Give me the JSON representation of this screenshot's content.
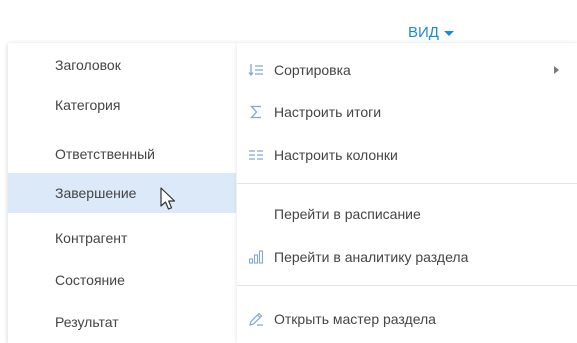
{
  "header": {
    "view_label": "ВИД"
  },
  "left_menu": {
    "items": [
      {
        "label": "Заголовок"
      },
      {
        "label": "Категория"
      },
      {
        "label": "Ответственный"
      },
      {
        "label": "Завершение"
      },
      {
        "label": "Контрагент"
      },
      {
        "label": "Состояние"
      },
      {
        "label": "Результат"
      }
    ],
    "active_item": "Завершение"
  },
  "right_menu": {
    "items": [
      {
        "label": "Сортировка",
        "icon": "sort-icon"
      },
      {
        "label": "Настроить итоги",
        "icon": "sigma-icon"
      },
      {
        "label": "Настроить колонки",
        "icon": "columns-icon"
      },
      {
        "label": "Перейти в расписание",
        "icon": ""
      },
      {
        "label": "Перейти в аналитику раздела",
        "icon": "bar-chart-icon"
      },
      {
        "label": "Открыть мастер раздела",
        "icon": "pencil-icon"
      }
    ]
  },
  "colors": {
    "accent": "#1d8ad8",
    "icon": "#7fa8d3",
    "highlight": "#dbe9f8",
    "text": "#444444"
  }
}
